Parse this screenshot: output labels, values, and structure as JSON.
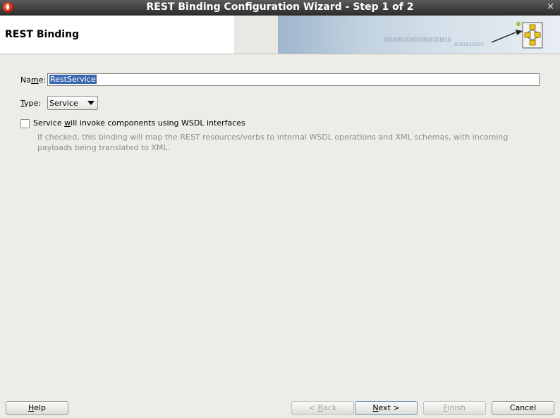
{
  "window": {
    "title": "REST Binding Configuration Wizard - Step 1 of 2",
    "close_glyph": "×"
  },
  "header": {
    "title": "REST Binding",
    "banner_binary_1": "1010101010101010101010",
    "banner_binary_2": "0101010101"
  },
  "form": {
    "name_label": {
      "pre": "Na",
      "mnemonic": "m",
      "post": "e:"
    },
    "name_value": "RestService",
    "type_label": {
      "pre": "",
      "mnemonic": "T",
      "post": "ype:"
    },
    "type_value": "Service",
    "wsdl_checkbox": {
      "checked": false,
      "label_pre": "Service ",
      "label_mnemonic": "w",
      "label_post": "ill invoke components using WSDL interfaces",
      "hint": "If checked, this binding will map the REST resources/verbs to internal WSDL operations and XML schemas, with incoming payloads being translated to XML."
    }
  },
  "buttons": {
    "help": {
      "mnemonic": "H",
      "rest": "elp"
    },
    "back": {
      "pre": "< ",
      "mnemonic": "B",
      "rest": "ack"
    },
    "next": {
      "mnemonic": "N",
      "rest": "ext >"
    },
    "finish": {
      "mnemonic": "F",
      "rest": "inish"
    },
    "cancel": {
      "label": "Cancel"
    }
  },
  "icons": {
    "app": "oracle-app-icon",
    "close": "close-icon",
    "wizard": "wizard-flow-icon",
    "dropdown": "chevron-down-icon"
  }
}
